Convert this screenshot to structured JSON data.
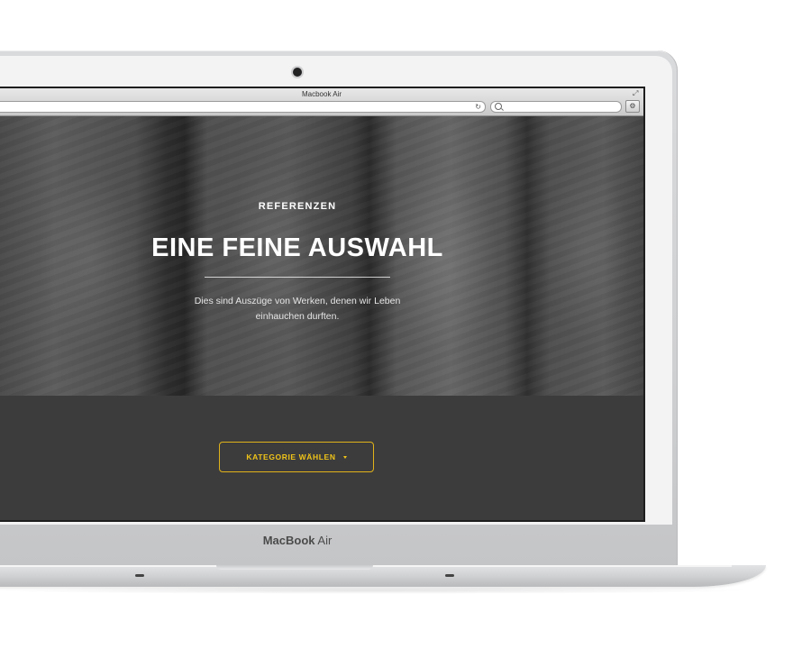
{
  "device": {
    "label_bold": "MacBook",
    "label_light": "Air"
  },
  "browser": {
    "window_title": "Macbook Air"
  },
  "hero": {
    "eyebrow": "REFERENZEN",
    "headline": "EINE FEINE AUSWAHL",
    "subtext": "Dies sind Auszüge von Werken, denen wir Leben einhauchen durften."
  },
  "category": {
    "button_label": "KATEGORIE WÄHLEN"
  },
  "icons": {
    "reload": "reload-icon",
    "search": "search-icon",
    "expand": "expand-icon",
    "caret": "caret-down-icon"
  },
  "colors": {
    "accent": "#f0c419",
    "section_bg": "#3c3c3c",
    "hero_text": "#ffffff"
  }
}
